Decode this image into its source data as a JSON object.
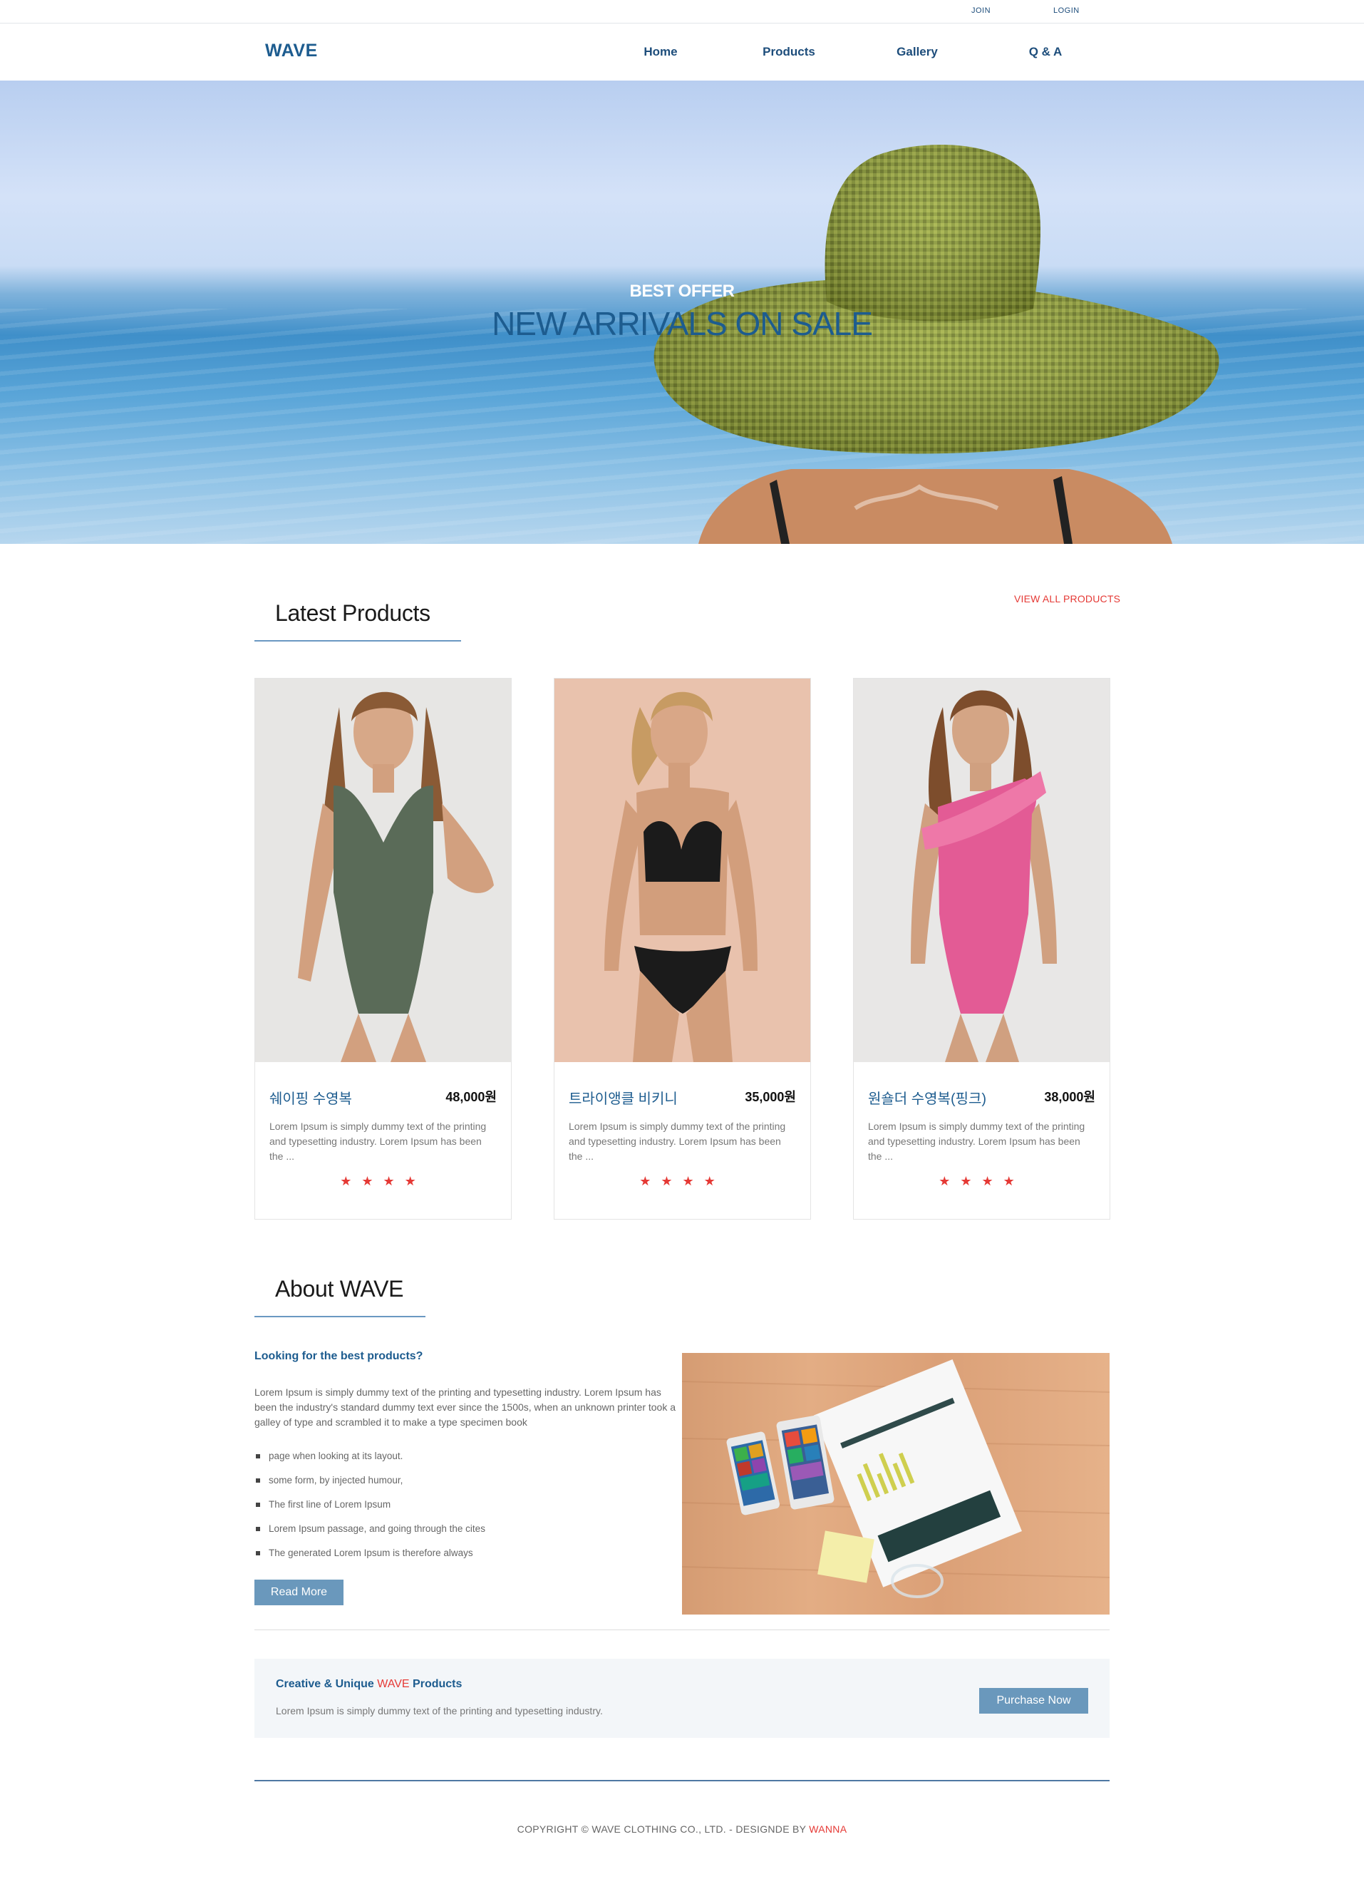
{
  "topbar": {
    "join": "JOIN",
    "login": "LOGIN"
  },
  "nav": {
    "logo": "WAVE",
    "items": [
      "Home",
      "Products",
      "Gallery",
      "Q & A"
    ]
  },
  "hero": {
    "subtitle": "BEST OFFER",
    "title": "NEW ARRIVALS ON SALE"
  },
  "latest": {
    "title": "Latest Products",
    "view_all": "VIEW ALL PRODUCTS",
    "products": [
      {
        "name": "쉐이핑 수영복",
        "price": "48,000원",
        "desc": "Lorem Ipsum is simply dummy text of the printing and typesetting industry. Lorem Ipsum has been the ...",
        "rating": 4,
        "swimsuit_color": "#5a6b58"
      },
      {
        "name": "트라이앵클 비키니",
        "price": "35,000원",
        "desc": "Lorem Ipsum is simply dummy text of the printing and typesetting industry. Lorem Ipsum has been the ...",
        "rating": 4,
        "swimsuit_color": "#1b1b1b"
      },
      {
        "name": "원숄더 수영복(핑크)",
        "price": "38,000원",
        "desc": "Lorem Ipsum is simply dummy text of the printing and typesetting industry. Lorem Ipsum has been the ...",
        "rating": 4,
        "swimsuit_color": "#e35b95"
      }
    ],
    "star_glyph": "★"
  },
  "about": {
    "title": "About WAVE",
    "question": "Looking for the best products?",
    "paragraph": "Lorem Ipsum is simply dummy text of the printing and typesetting industry. Lorem Ipsum has been the industry's standard dummy text ever since the 1500s, when an unknown printer took a galley of type and scrambled it to make a type specimen book",
    "list": [
      "page when looking at its layout.",
      "some form, by injected humour,",
      "The first line of Lorem Ipsum",
      "Lorem Ipsum passage, and going through the cites",
      "The generated Lorem Ipsum is therefore always"
    ],
    "read_more": "Read More"
  },
  "banner": {
    "title_prefix": "Creative & Unique ",
    "title_accent": "WAVE",
    "title_suffix": " Products",
    "desc": "Lorem Ipsum is simply dummy text of the printing and typesetting industry.",
    "button": "Purchase Now"
  },
  "footer": {
    "text": "COPYRIGHT © WAVE CLOTHING CO., LTD. - DESIGNDE BY ",
    "accent": "WANNA"
  },
  "colors": {
    "brand": "#1d5c8f",
    "accent": "#e53935",
    "button": "#6a98bc"
  }
}
